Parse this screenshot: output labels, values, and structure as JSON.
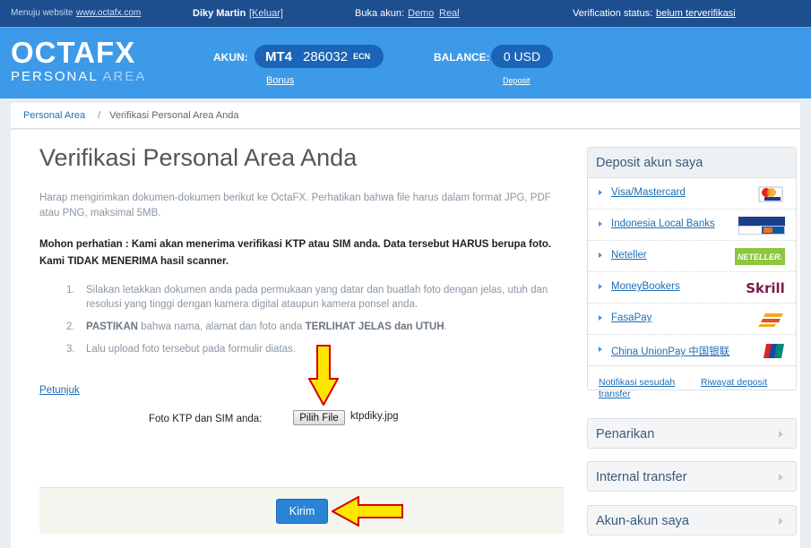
{
  "topbar": {
    "menuju_label": "Menuju website",
    "menuju_link": "www.octafx.com",
    "user_name": "Diky Martin",
    "logout": "[Keluar]",
    "buka_akun": "Buka akun:",
    "demo": "Demo",
    "real": "Real",
    "verification_label": "Verification status:",
    "verification_value": "belum terverifikasi"
  },
  "header": {
    "logo_top": "OCTAFX",
    "logo_personal": "PERSONAL",
    "logo_area": "AREA",
    "akun_label": "AKUN:",
    "platform": "MT4",
    "account_number": "286032",
    "account_type": "ECN",
    "bonus_link": "Bonus",
    "balance_label": "BALANCE:",
    "balance_value": "0 USD",
    "deposit_link": "Deposit"
  },
  "breadcrumb": {
    "home": "Personal Area",
    "separator": "/",
    "current": "Verifikasi Personal Area Anda"
  },
  "main": {
    "title": "Verifikasi Personal Area Anda",
    "intro": "Harap mengirimkan dokumen-dokumen berikut ke OctaFX. Perhatikan bahwa file harus dalam format JPG, PDF atau PNG, maksimal 5MB.",
    "notice": "Mohon perhatian : Kami akan menerima verifikasi KTP atau SIM anda. Data tersebut HARUS berupa foto. Kami TIDAK MENERIMA hasil scanner.",
    "steps": [
      {
        "num": "1.",
        "text": "Silakan letakkan dokumen anda pada permukaan yang datar dan buatlah foto dengan jelas, utuh dan resolusi yang tinggi dengan kamera digital ataupun kamera ponsel anda."
      },
      {
        "num": "2.",
        "b1": "PASTIKAN",
        "t1": " bahwa nama, alamat dan foto anda ",
        "b2": "TERLIHAT JELAS dan UTUH",
        "t2": "."
      },
      {
        "num": "3.",
        "text": "Lalu upload foto tersebut pada formulir diatas."
      }
    ],
    "petunjuk": "Petunjuk",
    "file_label": "Foto KTP dan SIM anda:",
    "file_button": "Pilih File",
    "file_name": "ktpdiky.jpg",
    "submit": "Kirim"
  },
  "sidebar": {
    "deposit_title": "Deposit akun saya",
    "methods": [
      {
        "label": "Visa/Mastercard",
        "icon": "visa-mastercard-icon"
      },
      {
        "label": "Indonesia Local Banks",
        "icon": "bca-mandiri-bni-icon"
      },
      {
        "label": "Neteller",
        "icon": "neteller-icon",
        "logo_text": "NETELLER."
      },
      {
        "label": "MoneyBookers",
        "icon": "skrill-icon",
        "logo_text": "Skrill"
      },
      {
        "label": "FasaPay",
        "icon": "fasapay-icon"
      },
      {
        "label": "China UnionPay 中国银联",
        "icon": "unionpay-icon"
      }
    ],
    "notif_link": "Notifikasi sesudah transfer",
    "riwayat_link": "Riwayat deposit",
    "penarikan": "Penarikan",
    "internal_transfer": "Internal transfer",
    "akun_akun": "Akun-akun saya"
  },
  "colors": {
    "header_blue": "#3c9ae8",
    "topbar_blue": "#1d4e8e",
    "arrow_fill": "#ffe600",
    "arrow_stroke": "#d40000"
  }
}
